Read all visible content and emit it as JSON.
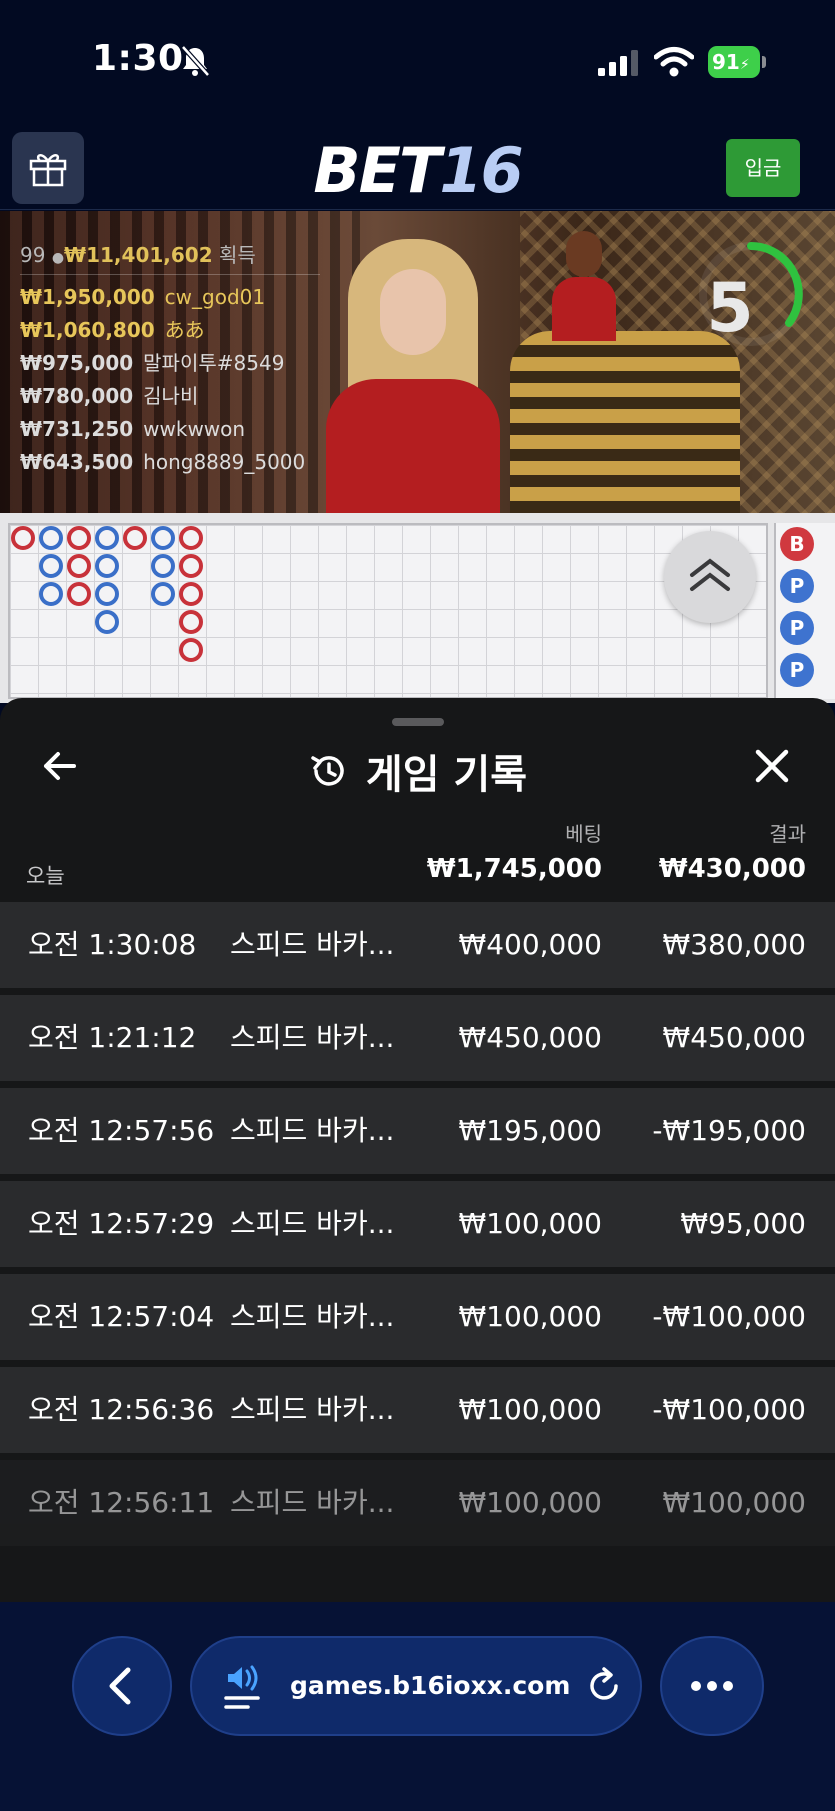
{
  "status_bar": {
    "time": "1:30",
    "battery": "91"
  },
  "header": {
    "logo_main": "BET",
    "logo_num": "16",
    "deposit_label": "입금"
  },
  "video": {
    "count": "99",
    "total_winnings": "₩11,401,602",
    "winnings_label": "획득",
    "winners": [
      {
        "amount": "₩1,950,000",
        "name": "cw_god01",
        "highlight": true
      },
      {
        "amount": "₩1,060,800",
        "name": "ああ",
        "highlight": true
      },
      {
        "amount": "₩975,000",
        "name": "말파이투#8549",
        "highlight": false
      },
      {
        "amount": "₩780,000",
        "name": "김나비",
        "highlight": false
      },
      {
        "amount": "₩731,250",
        "name": "wwkwwon",
        "highlight": false
      },
      {
        "amount": "₩643,500",
        "name": "hong8889_5000",
        "highlight": false
      }
    ],
    "timer": "5"
  },
  "road": {
    "side_chips": [
      "B",
      "P",
      "P",
      "P"
    ]
  },
  "history": {
    "title": "게임 기록",
    "col_bet": "베팅",
    "col_result": "결과",
    "today_label": "오늘",
    "total_bet": "₩1,745,000",
    "total_result": "₩430,000",
    "rows": [
      {
        "time": "오전 1:30:08",
        "game": "스피드 바카...",
        "bet": "₩400,000",
        "result": "₩380,000"
      },
      {
        "time": "오전 1:21:12",
        "game": "스피드 바카...",
        "bet": "₩450,000",
        "result": "₩450,000"
      },
      {
        "time": "오전 12:57:56",
        "game": "스피드 바카...",
        "bet": "₩195,000",
        "result": "-₩195,000"
      },
      {
        "time": "오전 12:57:29",
        "game": "스피드 바카...",
        "bet": "₩100,000",
        "result": "₩95,000"
      },
      {
        "time": "오전 12:57:04",
        "game": "스피드 바카...",
        "bet": "₩100,000",
        "result": "-₩100,000"
      },
      {
        "time": "오전 12:56:36",
        "game": "스피드 바카...",
        "bet": "₩100,000",
        "result": "-₩100,000"
      },
      {
        "time": "오전 12:56:11",
        "game": "스피드 바카...",
        "bet": "₩100,000",
        "result": "₩100,000"
      }
    ]
  },
  "browser": {
    "url": "games.b16ioxx.com"
  }
}
